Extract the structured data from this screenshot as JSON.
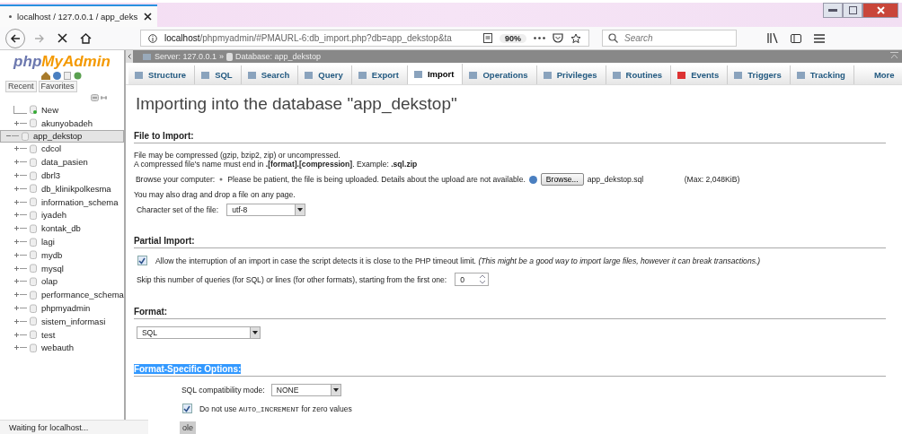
{
  "browser": {
    "tab_title": "localhost / 127.0.0.1 / app_deks",
    "url_host": "localhost",
    "url_path": "/phpmyadmin/#PMAURL-6:db_import.php?db=app_dekstop&ta",
    "zoom": "90%",
    "search": {
      "placeholder": "Search"
    }
  },
  "sidebar": {
    "logo_php": "php",
    "logo_rest": "MyAdmin",
    "buttons": [
      "Recent",
      "Favorites"
    ],
    "tree": [
      {
        "name": "New",
        "kind": "new",
        "selected": false
      },
      {
        "name": "akunyobadeh",
        "kind": "db",
        "expanded": false,
        "selected": false
      },
      {
        "name": "app_dekstop",
        "kind": "db",
        "expanded": true,
        "selected": true
      },
      {
        "name": "cdcol",
        "kind": "db",
        "expanded": false,
        "selected": false
      },
      {
        "name": "data_pasien",
        "kind": "db",
        "expanded": false,
        "selected": false
      },
      {
        "name": "dbrl3",
        "kind": "db",
        "expanded": false,
        "selected": false
      },
      {
        "name": "db_klinikpolkesma",
        "kind": "db",
        "expanded": false,
        "selected": false
      },
      {
        "name": "information_schema",
        "kind": "db",
        "expanded": false,
        "selected": false
      },
      {
        "name": "iyadeh",
        "kind": "db",
        "expanded": false,
        "selected": false
      },
      {
        "name": "kontak_db",
        "kind": "db",
        "expanded": false,
        "selected": false
      },
      {
        "name": "lagi",
        "kind": "db",
        "expanded": false,
        "selected": false
      },
      {
        "name": "mydb",
        "kind": "db",
        "expanded": false,
        "selected": false
      },
      {
        "name": "mysql",
        "kind": "db",
        "expanded": false,
        "selected": false
      },
      {
        "name": "olap",
        "kind": "db",
        "expanded": false,
        "selected": false
      },
      {
        "name": "performance_schema",
        "kind": "db",
        "expanded": false,
        "selected": false
      },
      {
        "name": "phpmyadmin",
        "kind": "db",
        "expanded": false,
        "selected": false
      },
      {
        "name": "sistem_informasi",
        "kind": "db",
        "expanded": false,
        "selected": false
      },
      {
        "name": "test",
        "kind": "db",
        "expanded": false,
        "selected": false
      },
      {
        "name": "webauth",
        "kind": "db",
        "expanded": false,
        "selected": false
      }
    ]
  },
  "breadcrumb": {
    "server": "Server: 127.0.0.1",
    "separator": "»",
    "database": "Database: app_dekstop"
  },
  "tabs": [
    {
      "label": "Structure",
      "selected": false
    },
    {
      "label": "SQL",
      "selected": false
    },
    {
      "label": "Search",
      "selected": false
    },
    {
      "label": "Query",
      "selected": false
    },
    {
      "label": "Export",
      "selected": false
    },
    {
      "label": "Import",
      "selected": true
    },
    {
      "label": "Operations",
      "selected": false
    },
    {
      "label": "Privileges",
      "selected": false
    },
    {
      "label": "Routines",
      "selected": false
    },
    {
      "label": "Events",
      "selected": false
    },
    {
      "label": "Triggers",
      "selected": false
    },
    {
      "label": "Tracking",
      "selected": false
    },
    {
      "label": "More",
      "selected": false
    }
  ],
  "heading": "Importing into the database \"app_dekstop\"",
  "file_section": {
    "title": "File to Import:",
    "note_1": "File may be compressed (gzip, bzip2, zip) or uncompressed.",
    "note_2": "A compressed file's name must end in **.[format].[compression]**. Example: **.sql.zip**",
    "browse_label": "Browse your computer:",
    "upload_note": "Please be patient, the file is being uploaded. Details about the upload are not available.",
    "browse_button": "Browse...",
    "file_name": "app_dekstop.sql",
    "max": "(Max: 2,048KiB)",
    "drag_note": "You may also drag and drop a file on any page.",
    "charset_label": "Character set of the file:",
    "charset": "utf-8"
  },
  "partial_section": {
    "title": "Partial Import:",
    "allow_interrupt": {
      "checked": true,
      "label": "Allow the interruption of an import in case the script detects it is close to the PHP timeout limit. *(This might be a good way to import large files, however it can break transactions.)*"
    },
    "skip_label": "Skip this number of queries (for SQL) or lines (for other formats), starting from the first one:",
    "skip_value": "0"
  },
  "format_section": {
    "title": "Format:",
    "format": "SQL"
  },
  "options_section": {
    "title": "Format-Specific Options:",
    "highlighted": true,
    "compat_label": "SQL compatibility mode:",
    "compat": "NONE",
    "no_auto_increment": {
      "checked": true,
      "label_before": "Do not use",
      "code": "AUTO_INCREMENT",
      "label_after": "for zero values"
    }
  },
  "console_tab": "ole",
  "status_bar": "Waiting for localhost..."
}
